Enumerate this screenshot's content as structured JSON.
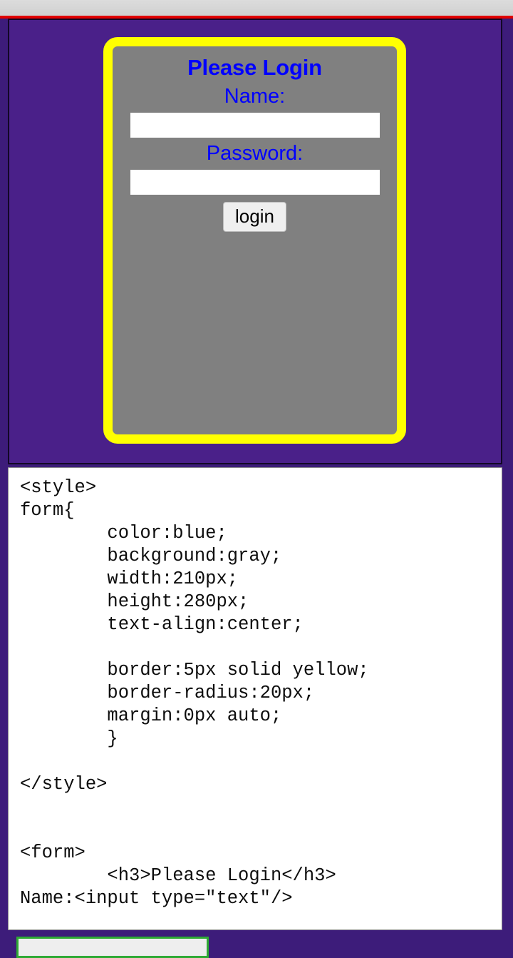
{
  "browser": {
    "statusbar_color": "#d4d4d4",
    "accent_rule_color": "#e00000"
  },
  "preview": {
    "background_color": "#4a2089",
    "form": {
      "title": "Please Login",
      "title_color": "#0000ff",
      "background_color": "#808080",
      "border_color": "#ffff00",
      "name_label": "Name:",
      "name_value": "",
      "name_placeholder": "",
      "password_label": "Password:",
      "password_value": "",
      "password_placeholder": "",
      "login_button_label": "login"
    }
  },
  "code_panel": {
    "source": "<style>\nform{\n        color:blue;\n        background:gray;\n        width:210px;\n        height:280px;\n        text-align:center;\n\n        border:5px solid yellow;\n        border-radius:20px;\n        margin:0px auto;\n        }\n\n</style>\n\n\n<form>\n        <h3>Please Login</h3>\nName:<input type=\"text\"/>",
    "resize_handle": "⌐"
  },
  "bottom_panel": {
    "border_color": "#2eaa34",
    "background_color": "#eeeeee"
  }
}
